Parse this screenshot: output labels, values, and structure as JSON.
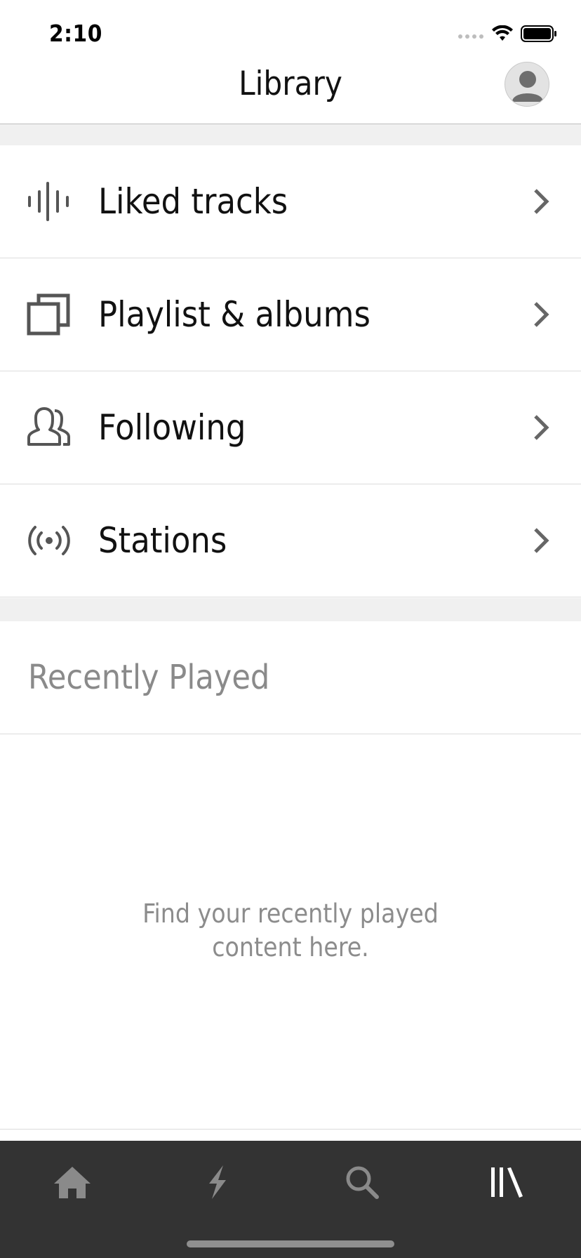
{
  "status_bar": {
    "time": "2:10"
  },
  "nav": {
    "title": "Library",
    "avatar_icon": "user-avatar-icon"
  },
  "menu": {
    "items": [
      {
        "label": "Liked tracks",
        "icon": "waveform-icon"
      },
      {
        "label": "Playlist & albums",
        "icon": "stacked-squares-icon"
      },
      {
        "label": "Following",
        "icon": "people-icon"
      },
      {
        "label": "Stations",
        "icon": "broadcast-icon"
      }
    ]
  },
  "recently_played": {
    "title": "Recently Played",
    "empty_line1": "Find your recently played",
    "empty_line2": "content here."
  },
  "tab_bar": {
    "tabs": [
      {
        "icon": "home-icon",
        "active": false
      },
      {
        "icon": "lightning-icon",
        "active": false
      },
      {
        "icon": "search-icon",
        "active": false
      },
      {
        "icon": "library-icon",
        "active": true
      }
    ],
    "colors": {
      "active": "#ffffff",
      "inactive": "#8a8a8a",
      "background": "#333333"
    }
  }
}
